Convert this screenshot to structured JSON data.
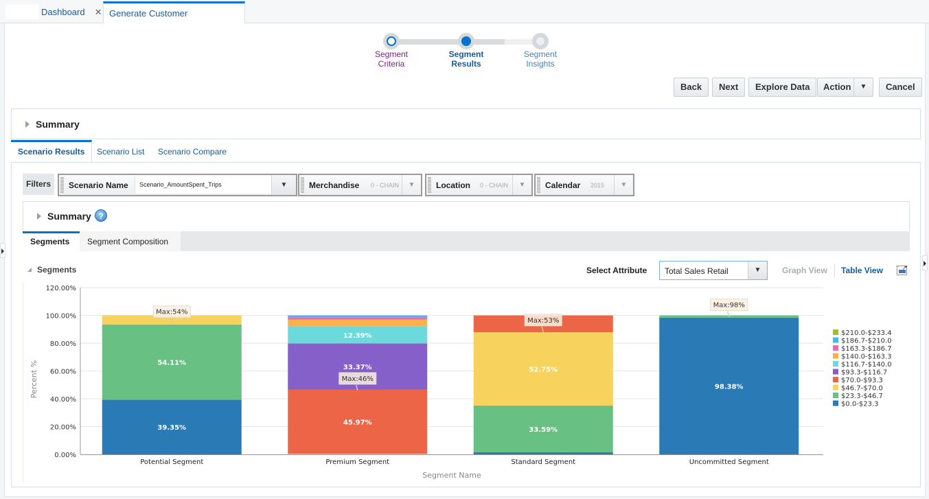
{
  "tabs": [
    {
      "label": "Dashboard",
      "closable": true,
      "active": false
    },
    {
      "label": "Generate Customer Segment",
      "closable": true,
      "active": true
    }
  ],
  "close_glyph": "✕",
  "train": {
    "stops": [
      {
        "label_line1": "Segment",
        "label_line2": "Criteria",
        "state": "visited"
      },
      {
        "label_line1": "Segment",
        "label_line2": "Results",
        "state": "current"
      },
      {
        "label_line1": "Segment",
        "label_line2": "Insights",
        "state": "unvisited"
      }
    ]
  },
  "toolbar": {
    "back": "Back",
    "next": "Next",
    "explore": "Explore Data",
    "action": "Action",
    "cancel": "Cancel",
    "dropdown_glyph": "▼"
  },
  "summary_title": "Summary",
  "scenario_tabs": [
    {
      "label": "Scenario Results",
      "active": true
    },
    {
      "label": "Scenario List",
      "active": false
    },
    {
      "label": "Scenario Compare",
      "active": false
    }
  ],
  "filters": {
    "label": "Filters",
    "scenario": {
      "name": "Scenario Name",
      "value": "Scenario_AmountSpent_Trips"
    },
    "merchandise": {
      "name": "Merchandise",
      "value": "0 - CHAIN"
    },
    "location": {
      "name": "Location",
      "value": "0 - CHAIN"
    },
    "calendar": {
      "name": "Calendar",
      "value": "2015"
    }
  },
  "summary2": {
    "title": "Summary",
    "help_glyph": "?"
  },
  "segment_tabs": [
    {
      "label": "Segments",
      "active": true
    },
    {
      "label": "Segment Composition",
      "active": false
    }
  ],
  "segments_header": "Segments",
  "select_attribute": {
    "label": "Select Attribute",
    "value": "Total Sales Retail"
  },
  "views": {
    "graph": "Graph View",
    "table": "Table View"
  },
  "chart_data": {
    "type": "bar",
    "stacked": true,
    "xlabel": "Segment Name",
    "ylabel": "Percent %",
    "ylim": [
      0,
      120
    ],
    "yticks": [
      0,
      20,
      40,
      60,
      80,
      100,
      120
    ],
    "ytick_labels": [
      "0.00%",
      "20.00%",
      "40.00%",
      "60.00%",
      "80.00%",
      "100.00%",
      "120.00%"
    ],
    "grid": true,
    "legend_position": "right",
    "categories": [
      "Potential Segment",
      "Premium Segment",
      "Standard Segment",
      "Uncommitted Segment"
    ],
    "series": [
      {
        "name": "$0.0-$23.3",
        "color": "#2a7ab5",
        "values": [
          39.35,
          0,
          1.5,
          98.38
        ]
      },
      {
        "name": "$23.3-$46.7",
        "color": "#68c183",
        "values": [
          54.11,
          0,
          33.59,
          1.62
        ]
      },
      {
        "name": "$46.7-$70.0",
        "color": "#f7d35d",
        "values": [
          6.54,
          0.5,
          52.75,
          0
        ]
      },
      {
        "name": "$70.0-$93.3",
        "color": "#ec6547",
        "values": [
          0,
          45.97,
          12.16,
          0
        ]
      },
      {
        "name": "$93.3-$116.7",
        "color": "#8560c8",
        "values": [
          0,
          33.37,
          0,
          0
        ]
      },
      {
        "name": "$116.7-$140.0",
        "color": "#6cdadb",
        "values": [
          0,
          12.39,
          0,
          0
        ]
      },
      {
        "name": "$140.0-$163.3",
        "color": "#fdb14d",
        "values": [
          0,
          4.8,
          0,
          0
        ]
      },
      {
        "name": "$163.3-$186.7",
        "color": "#e46db3",
        "values": [
          0,
          1.6,
          0,
          0
        ]
      },
      {
        "name": "$186.7-$210.0",
        "color": "#44b7ec",
        "values": [
          0,
          1.37,
          0,
          0
        ]
      },
      {
        "name": "$210.0-$233.4",
        "color": "#9fbd33",
        "values": [
          0,
          0,
          0,
          0
        ]
      }
    ],
    "data_labels": [
      {
        "category": 0,
        "series": 0,
        "text": "39.35%"
      },
      {
        "category": 0,
        "series": 1,
        "text": "54.11%"
      },
      {
        "category": 1,
        "series": 3,
        "text": "45.97%"
      },
      {
        "category": 1,
        "series": 4,
        "text": "33.37%"
      },
      {
        "category": 1,
        "series": 5,
        "text": "12.39%"
      },
      {
        "category": 2,
        "series": 1,
        "text": "33.59%"
      },
      {
        "category": 2,
        "series": 2,
        "text": "52.75%"
      },
      {
        "category": 3,
        "series": 0,
        "text": "98.38%"
      }
    ],
    "annotations": [
      {
        "category": 0,
        "text": "Max:54%",
        "anchor_value": 94
      },
      {
        "category": 1,
        "text": "Max:46%",
        "anchor_value": 46
      },
      {
        "category": 2,
        "text": "Max:53%",
        "anchor_value": 88
      },
      {
        "category": 3,
        "text": "Max:98%",
        "anchor_value": 99
      }
    ]
  }
}
